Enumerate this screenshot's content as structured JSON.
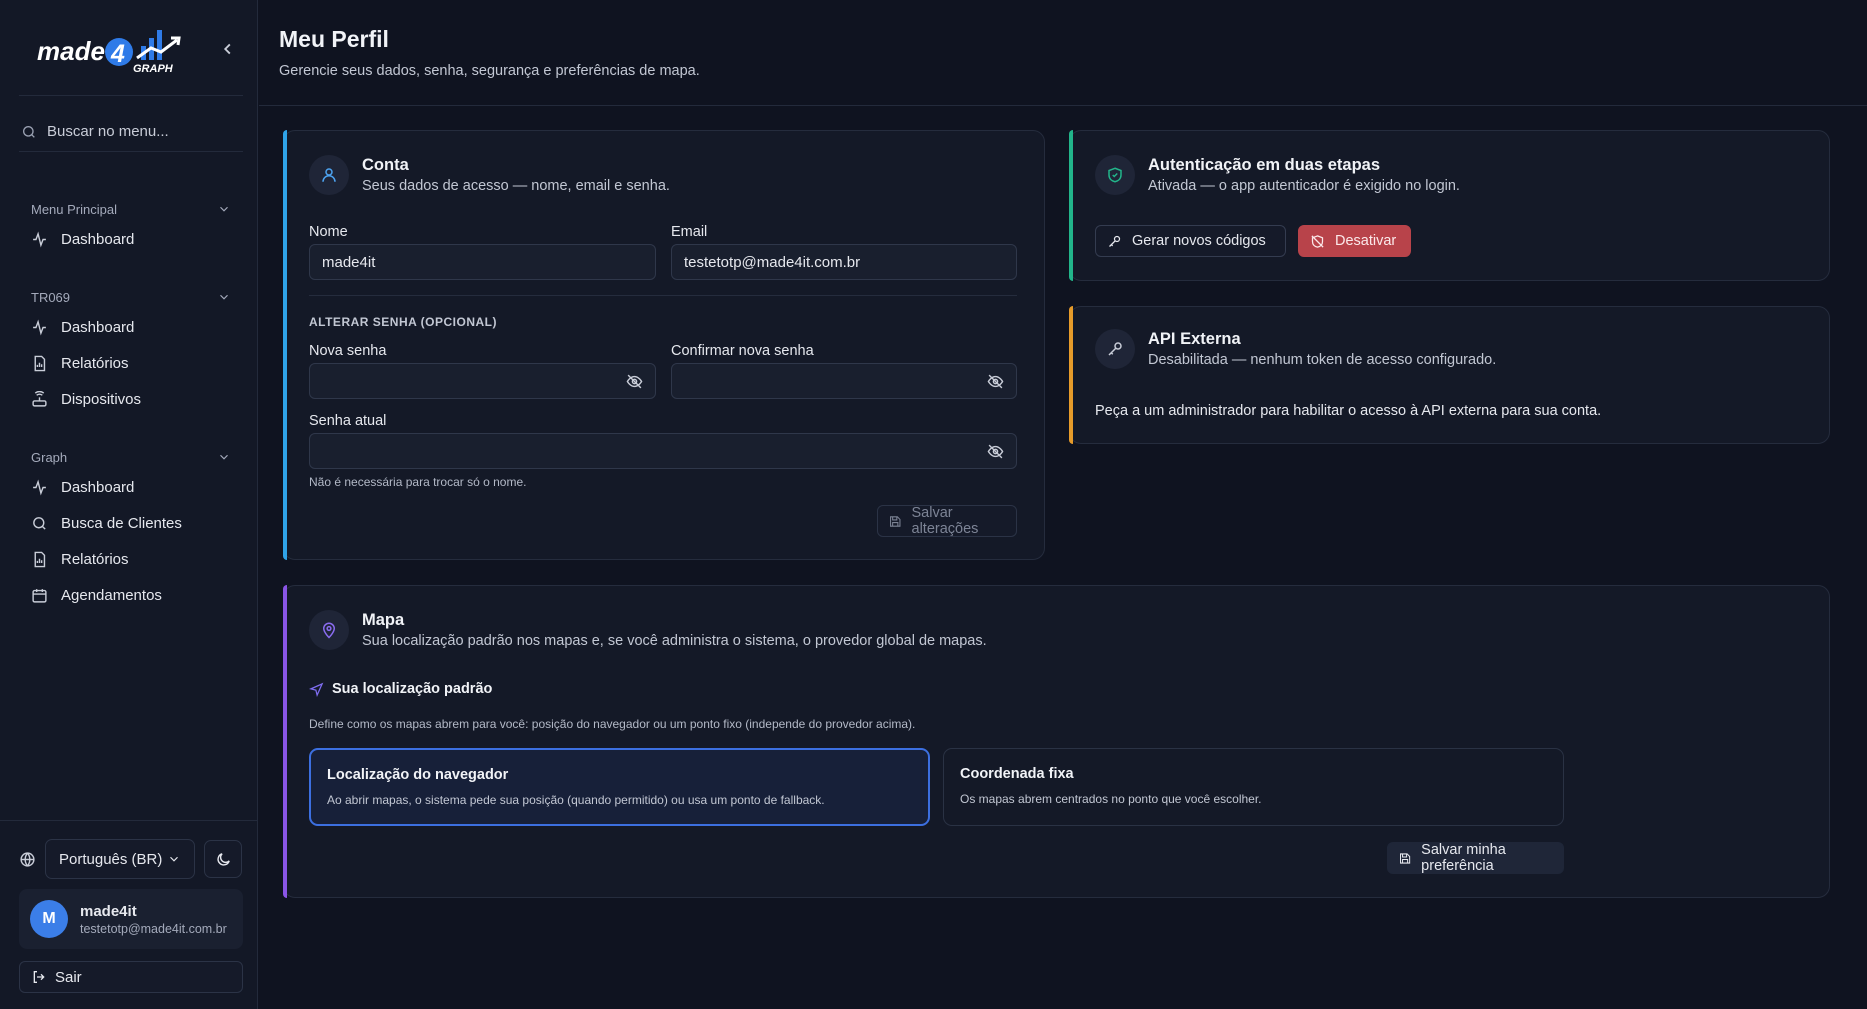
{
  "brand": {
    "logo_text": "made",
    "logo_number": "4",
    "logo_sub": "GRAPH"
  },
  "sidebar": {
    "search_placeholder": "Buscar no menu...",
    "groups": [
      {
        "label": "Menu Principal",
        "items": [
          {
            "label": "Dashboard",
            "icon": "activity-icon"
          }
        ]
      },
      {
        "label": "TR069",
        "items": [
          {
            "label": "Dashboard",
            "icon": "activity-icon"
          },
          {
            "label": "Relatórios",
            "icon": "report-icon"
          },
          {
            "label": "Dispositivos",
            "icon": "router-icon"
          }
        ]
      },
      {
        "label": "Graph",
        "items": [
          {
            "label": "Dashboard",
            "icon": "activity-icon"
          },
          {
            "label": "Busca de Clientes",
            "icon": "search-icon"
          },
          {
            "label": "Relatórios",
            "icon": "report-icon"
          },
          {
            "label": "Agendamentos",
            "icon": "calendar-icon"
          }
        ]
      }
    ],
    "language": "Português (BR)",
    "user": {
      "initial": "M",
      "name": "made4it",
      "email": "testetotp@made4it.com.br"
    },
    "logout_label": "Sair"
  },
  "page": {
    "title": "Meu Perfil",
    "subtitle": "Gerencie seus dados, senha, segurança e preferências de mapa."
  },
  "account": {
    "title": "Conta",
    "description": "Seus dados de acesso — nome, email e senha.",
    "name_label": "Nome",
    "name_value": "made4it",
    "email_label": "Email",
    "email_value": "testetotp@made4it.com.br",
    "password_section": "ALTERAR SENHA (OPCIONAL)",
    "new_password_label": "Nova senha",
    "confirm_password_label": "Confirmar nova senha",
    "current_password_label": "Senha atual",
    "hint": "Não é necessária para trocar só o nome.",
    "save_label": "Salvar alterações"
  },
  "two_factor": {
    "title": "Autenticação em duas etapas",
    "description": "Ativada — o app autenticador é exigido no login.",
    "generate_label": "Gerar novos códigos",
    "disable_label": "Desativar"
  },
  "api": {
    "title": "API Externa",
    "description": "Desabilitada — nenhum token de acesso configurado.",
    "message": "Peça a um administrador para habilitar o acesso à API externa para sua conta."
  },
  "map": {
    "title": "Mapa",
    "description": "Sua localização padrão nos mapas e, se você administra o sistema, o provedor global de mapas.",
    "location_heading": "Sua localização padrão",
    "location_description": "Define como os mapas abrem para você: posição do navegador ou um ponto fixo (independe do provedor acima).",
    "options": [
      {
        "title": "Localização do navegador",
        "description": "Ao abrir mapas, o sistema pede sua posição (quando permitido) ou usa um ponto de fallback.",
        "selected": true
      },
      {
        "title": "Coordenada fixa",
        "description": "Os mapas abrem centrados no ponto que você escolher.",
        "selected": false
      }
    ],
    "save_label": "Salvar minha preferência"
  },
  "colors": {
    "accent_blue": "#2fa3e8",
    "accent_green": "#22b58a",
    "accent_orange": "#e69b2a",
    "accent_purple": "#8a55e6",
    "danger": "#b8434a",
    "selected_border": "#3c6fe0"
  }
}
